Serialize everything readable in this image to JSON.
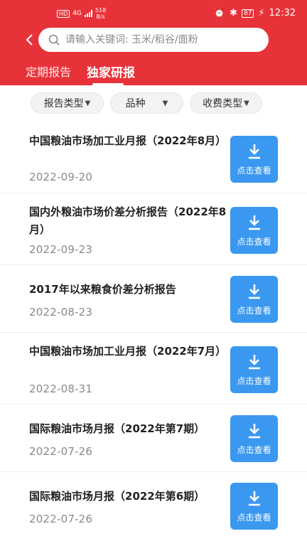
{
  "statusbar": {
    "hd": "HD",
    "signal": "4G",
    "net_speed_value": "518",
    "net_speed_unit": "B/s",
    "battery": "87",
    "time": "12:32"
  },
  "search": {
    "placeholder": "请输入关键词: 玉米/稻谷/面粉"
  },
  "tabs": [
    {
      "label": "定期报告",
      "active": false
    },
    {
      "label": "独家研报",
      "active": true
    }
  ],
  "filters": [
    {
      "label": "报告类型"
    },
    {
      "label": "品种"
    },
    {
      "label": "收费类型"
    }
  ],
  "download_label": "点击查看",
  "reports": [
    {
      "title": "中国粮油市场加工业月报（2022年8月）",
      "date": "2022-09-20"
    },
    {
      "title": "国内外粮油市场价差分析报告（2022年8月）",
      "date": "2022-09-23"
    },
    {
      "title": "2017年以来粮食价差分析报告",
      "date": "2022-08-23"
    },
    {
      "title": "中国粮油市场加工业月报（2022年7月）",
      "date": "2022-08-31"
    },
    {
      "title": "国际粮油市场月报（2022年第7期）",
      "date": "2022-07-26"
    },
    {
      "title": "国际粮油市场月报（2022年第6期）",
      "date": "2022-07-26"
    }
  ],
  "colors": {
    "brand_red": "#e8323a",
    "download_blue": "#3a98f0"
  }
}
